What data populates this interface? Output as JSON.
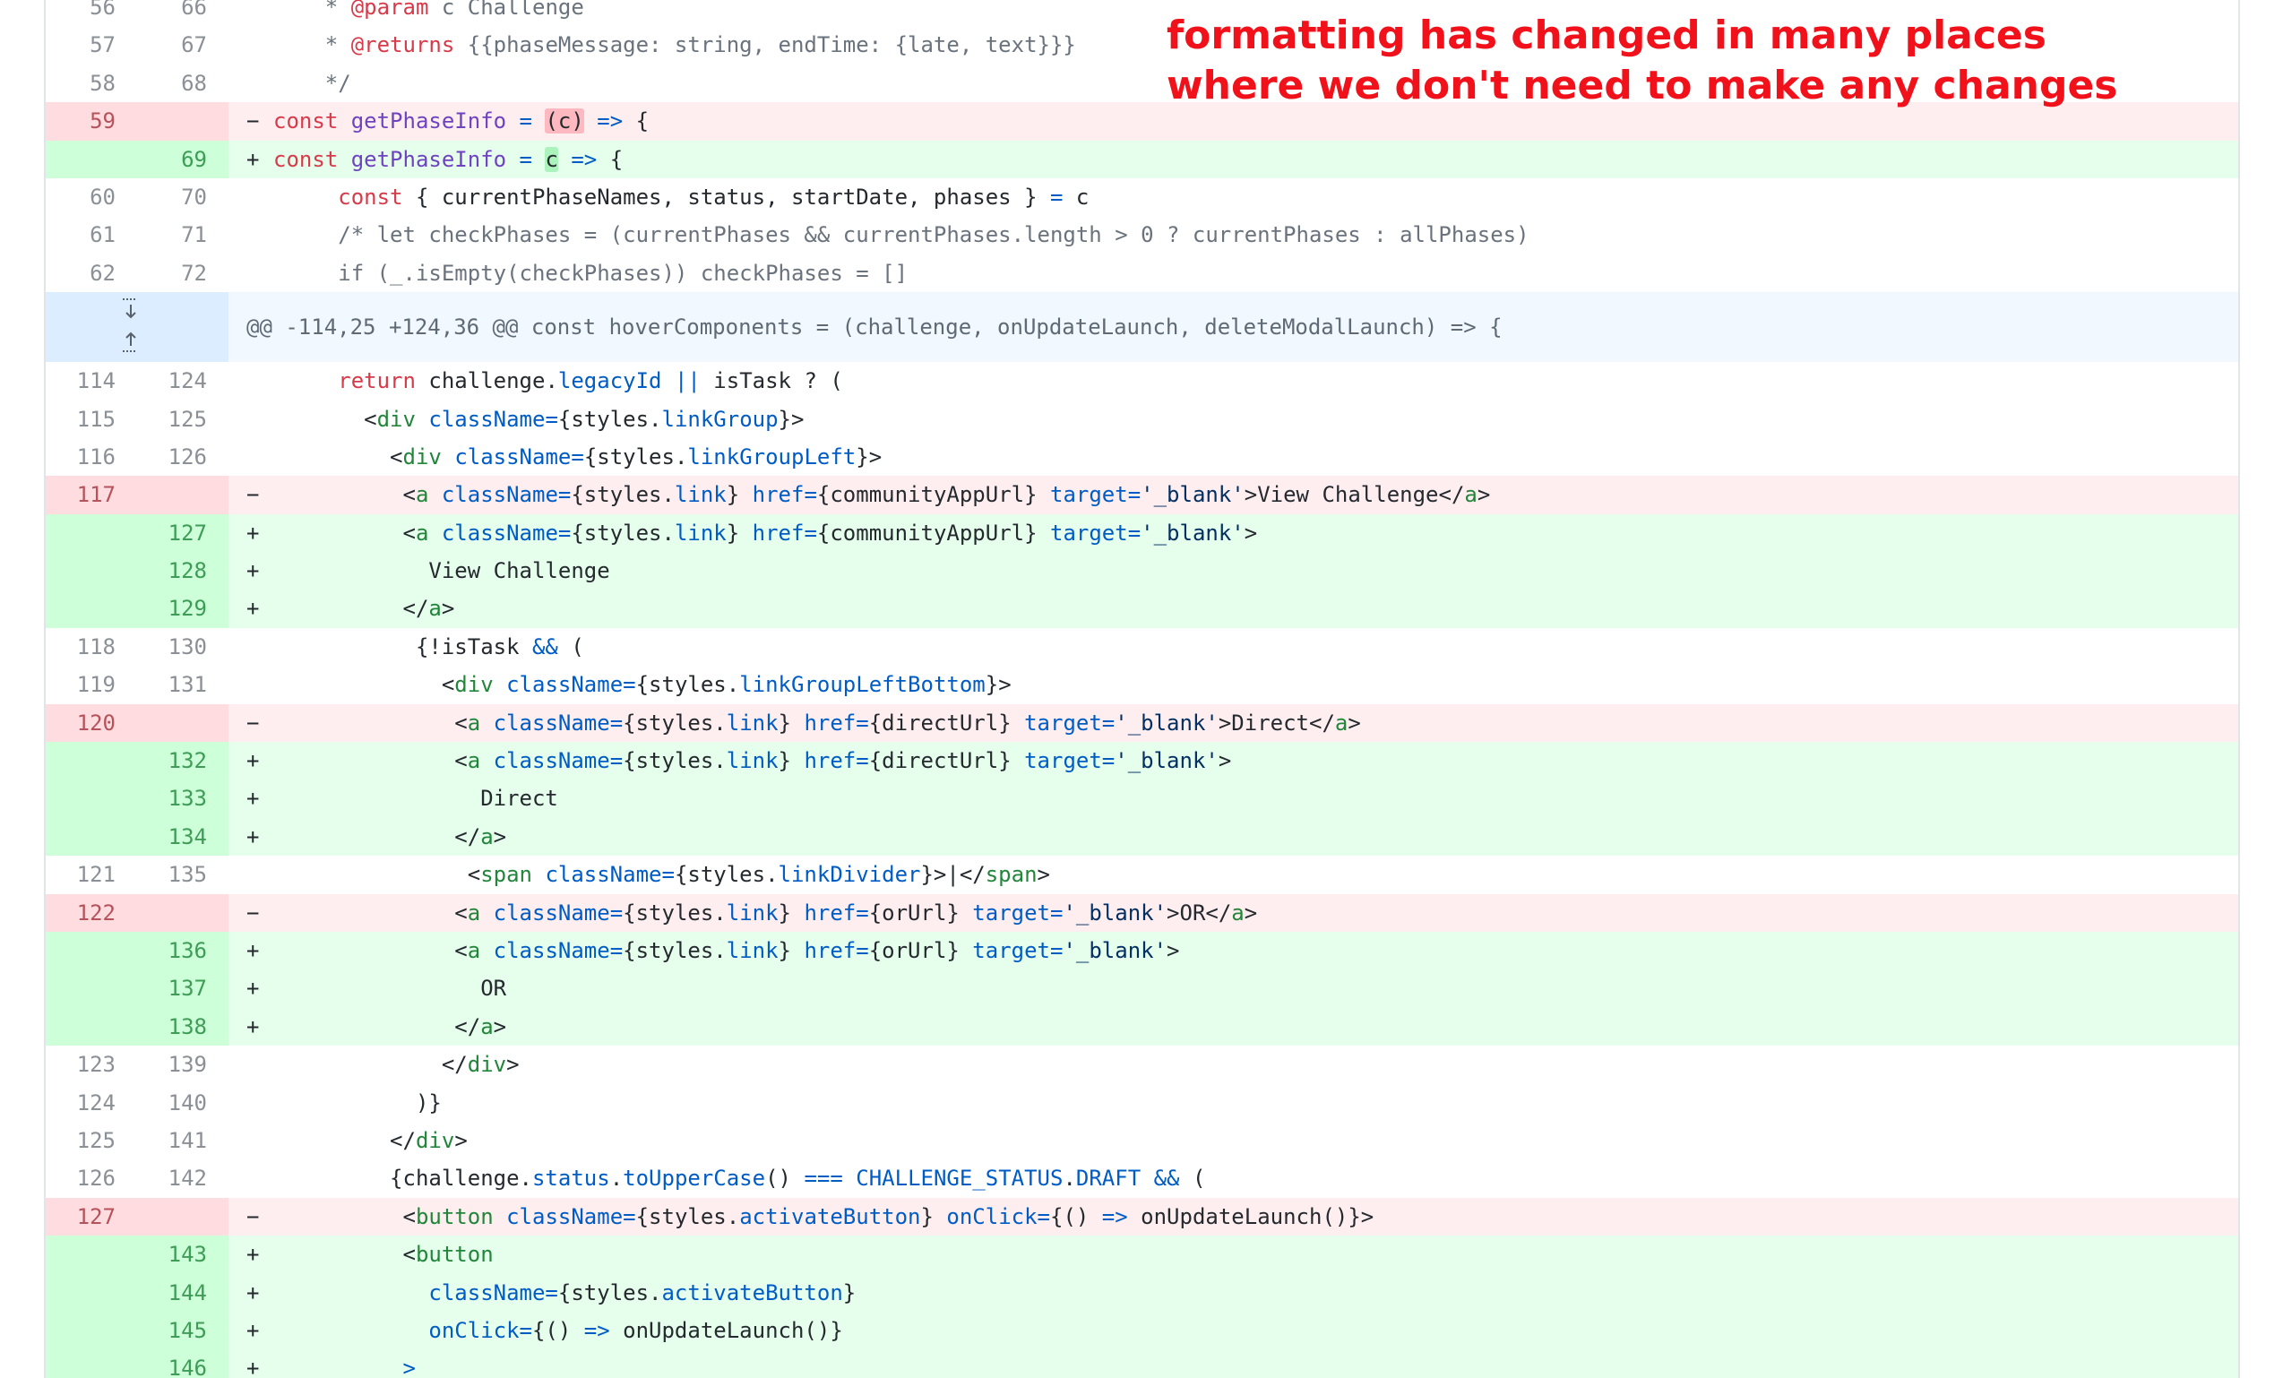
{
  "annotation": {
    "line1": "formatting has changed in many places",
    "line2": "where we don't need to make any changes"
  },
  "diff_lines": [
    {
      "type": "ctx",
      "old": "56",
      "new": "66",
      "tokens": [
        [
          "cm",
          "    * "
        ],
        [
          "kw",
          "@param"
        ],
        [
          "cm",
          " c Challenge"
        ]
      ]
    },
    {
      "type": "ctx",
      "old": "57",
      "new": "67",
      "tokens": [
        [
          "cm",
          "    * "
        ],
        [
          "kw",
          "@returns"
        ],
        [
          "cm",
          " {{phaseMessage: string, endTime: {late, text}}}"
        ]
      ]
    },
    {
      "type": "ctx",
      "old": "58",
      "new": "68",
      "tokens": [
        [
          "cm",
          "    */"
        ]
      ]
    },
    {
      "type": "del",
      "old": "59",
      "new": "",
      "marker": "−",
      "tokens": [
        [
          "kw",
          "const "
        ],
        [
          "fn",
          "getPhaseInfo"
        ],
        [
          "at",
          " = "
        ],
        [
          "hl-del",
          "(c)"
        ],
        [
          "at",
          " =>"
        ],
        [
          "",
          " {"
        ]
      ]
    },
    {
      "type": "add",
      "old": "",
      "new": "69",
      "marker": "+",
      "tokens": [
        [
          "kw",
          "const "
        ],
        [
          "fn",
          "getPhaseInfo"
        ],
        [
          "at",
          " = "
        ],
        [
          "hl-add",
          "c"
        ],
        [
          "at",
          " =>"
        ],
        [
          "",
          " {"
        ]
      ]
    },
    {
      "type": "ctx",
      "old": "60",
      "new": "70",
      "tokens": [
        [
          "",
          "     "
        ],
        [
          "kw",
          "const"
        ],
        [
          "",
          " { currentPhaseNames, status, startDate, phases } "
        ],
        [
          "at",
          "="
        ],
        [
          "",
          " c"
        ]
      ]
    },
    {
      "type": "ctx",
      "old": "61",
      "new": "71",
      "tokens": [
        [
          "cm",
          "     /* let checkPhases = (currentPhases && currentPhases.length > 0 ? currentPhases : allPhases)"
        ]
      ]
    },
    {
      "type": "ctx",
      "old": "62",
      "new": "72",
      "tokens": [
        [
          "cm",
          "     if (_.isEmpty(checkPhases)) checkPhases = []"
        ]
      ]
    },
    {
      "type": "hunk",
      "old": "",
      "new": "",
      "tokens": [
        [
          "",
          "@@ -114,25 +124,36 @@ const hoverComponents = (challenge, onUpdateLaunch, deleteModalLaunch) => {"
        ]
      ]
    },
    {
      "type": "ctx",
      "old": "114",
      "new": "124",
      "tokens": [
        [
          "",
          "     "
        ],
        [
          "kw",
          "return"
        ],
        [
          "",
          " challenge."
        ],
        [
          "at",
          "legacyId"
        ],
        [
          "",
          " "
        ],
        [
          "at",
          "||"
        ],
        [
          "",
          " isTask ? ("
        ]
      ]
    },
    {
      "type": "ctx",
      "old": "115",
      "new": "125",
      "tokens": [
        [
          "",
          "       <"
        ],
        [
          "tg",
          "div"
        ],
        [
          "",
          " "
        ],
        [
          "at",
          "className="
        ],
        [
          "",
          "{styles."
        ],
        [
          "at",
          "linkGroup"
        ],
        [
          "",
          "}>"
        ]
      ]
    },
    {
      "type": "ctx",
      "old": "116",
      "new": "126",
      "tokens": [
        [
          "",
          "         <"
        ],
        [
          "tg",
          "div"
        ],
        [
          "",
          " "
        ],
        [
          "at",
          "className="
        ],
        [
          "",
          "{styles."
        ],
        [
          "at",
          "linkGroupLeft"
        ],
        [
          "",
          "}>"
        ]
      ]
    },
    {
      "type": "del",
      "old": "117",
      "new": "",
      "marker": "−",
      "tokens": [
        [
          "",
          "          <"
        ],
        [
          "tg",
          "a"
        ],
        [
          "",
          " "
        ],
        [
          "at",
          "className="
        ],
        [
          "",
          "{styles."
        ],
        [
          "at",
          "link"
        ],
        [
          "",
          "} "
        ],
        [
          "at",
          "href="
        ],
        [
          "",
          "{communityAppUrl} "
        ],
        [
          "at",
          "target="
        ],
        [
          "st",
          "'_blank'"
        ],
        [
          "",
          ">View Challenge</"
        ],
        [
          "tg",
          "a"
        ],
        [
          "",
          ">"
        ]
      ]
    },
    {
      "type": "add",
      "old": "",
      "new": "127",
      "marker": "+",
      "tokens": [
        [
          "",
          "          <"
        ],
        [
          "tg",
          "a"
        ],
        [
          "",
          " "
        ],
        [
          "at",
          "className="
        ],
        [
          "",
          "{styles."
        ],
        [
          "at",
          "link"
        ],
        [
          "",
          "} "
        ],
        [
          "at",
          "href="
        ],
        [
          "",
          "{communityAppUrl} "
        ],
        [
          "at",
          "target="
        ],
        [
          "st",
          "'_blank'"
        ],
        [
          "",
          ">"
        ]
      ]
    },
    {
      "type": "add",
      "old": "",
      "new": "128",
      "marker": "+",
      "tokens": [
        [
          "",
          "            View Challenge"
        ]
      ]
    },
    {
      "type": "add",
      "old": "",
      "new": "129",
      "marker": "+",
      "tokens": [
        [
          "",
          "          </"
        ],
        [
          "tg",
          "a"
        ],
        [
          "",
          ">"
        ]
      ]
    },
    {
      "type": "ctx",
      "old": "118",
      "new": "130",
      "tokens": [
        [
          "",
          "           {!isTask "
        ],
        [
          "at",
          "&&"
        ],
        [
          "",
          " ("
        ]
      ]
    },
    {
      "type": "ctx",
      "old": "119",
      "new": "131",
      "tokens": [
        [
          "",
          "             <"
        ],
        [
          "tg",
          "div"
        ],
        [
          "",
          " "
        ],
        [
          "at",
          "className="
        ],
        [
          "",
          "{styles."
        ],
        [
          "at",
          "linkGroupLeftBottom"
        ],
        [
          "",
          "}>"
        ]
      ]
    },
    {
      "type": "del",
      "old": "120",
      "new": "",
      "marker": "−",
      "tokens": [
        [
          "",
          "              <"
        ],
        [
          "tg",
          "a"
        ],
        [
          "",
          " "
        ],
        [
          "at",
          "className="
        ],
        [
          "",
          "{styles."
        ],
        [
          "at",
          "link"
        ],
        [
          "",
          "} "
        ],
        [
          "at",
          "href="
        ],
        [
          "",
          "{directUrl} "
        ],
        [
          "at",
          "target="
        ],
        [
          "st",
          "'_blank'"
        ],
        [
          "",
          ">Direct</"
        ],
        [
          "tg",
          "a"
        ],
        [
          "",
          ">"
        ]
      ]
    },
    {
      "type": "add",
      "old": "",
      "new": "132",
      "marker": "+",
      "tokens": [
        [
          "",
          "              <"
        ],
        [
          "tg",
          "a"
        ],
        [
          "",
          " "
        ],
        [
          "at",
          "className="
        ],
        [
          "",
          "{styles."
        ],
        [
          "at",
          "link"
        ],
        [
          "",
          "} "
        ],
        [
          "at",
          "href="
        ],
        [
          "",
          "{directUrl} "
        ],
        [
          "at",
          "target="
        ],
        [
          "st",
          "'_blank'"
        ],
        [
          "",
          ">"
        ]
      ]
    },
    {
      "type": "add",
      "old": "",
      "new": "133",
      "marker": "+",
      "tokens": [
        [
          "",
          "                Direct"
        ]
      ]
    },
    {
      "type": "add",
      "old": "",
      "new": "134",
      "marker": "+",
      "tokens": [
        [
          "",
          "              </"
        ],
        [
          "tg",
          "a"
        ],
        [
          "",
          ">"
        ]
      ]
    },
    {
      "type": "ctx",
      "old": "121",
      "new": "135",
      "tokens": [
        [
          "",
          "               <"
        ],
        [
          "tg",
          "span"
        ],
        [
          "",
          " "
        ],
        [
          "at",
          "className="
        ],
        [
          "",
          "{styles."
        ],
        [
          "at",
          "linkDivider"
        ],
        [
          "",
          "}>|</"
        ],
        [
          "tg",
          "span"
        ],
        [
          "",
          ">"
        ]
      ]
    },
    {
      "type": "del",
      "old": "122",
      "new": "",
      "marker": "−",
      "tokens": [
        [
          "",
          "              <"
        ],
        [
          "tg",
          "a"
        ],
        [
          "",
          " "
        ],
        [
          "at",
          "className="
        ],
        [
          "",
          "{styles."
        ],
        [
          "at",
          "link"
        ],
        [
          "",
          "} "
        ],
        [
          "at",
          "href="
        ],
        [
          "",
          "{orUrl} "
        ],
        [
          "at",
          "target="
        ],
        [
          "st",
          "'_blank'"
        ],
        [
          "",
          ">OR</"
        ],
        [
          "tg",
          "a"
        ],
        [
          "",
          ">"
        ]
      ]
    },
    {
      "type": "add",
      "old": "",
      "new": "136",
      "marker": "+",
      "tokens": [
        [
          "",
          "              <"
        ],
        [
          "tg",
          "a"
        ],
        [
          "",
          " "
        ],
        [
          "at",
          "className="
        ],
        [
          "",
          "{styles."
        ],
        [
          "at",
          "link"
        ],
        [
          "",
          "} "
        ],
        [
          "at",
          "href="
        ],
        [
          "",
          "{orUrl} "
        ],
        [
          "at",
          "target="
        ],
        [
          "st",
          "'_blank'"
        ],
        [
          "",
          ">"
        ]
      ]
    },
    {
      "type": "add",
      "old": "",
      "new": "137",
      "marker": "+",
      "tokens": [
        [
          "",
          "                OR"
        ]
      ]
    },
    {
      "type": "add",
      "old": "",
      "new": "138",
      "marker": "+",
      "tokens": [
        [
          "",
          "              </"
        ],
        [
          "tg",
          "a"
        ],
        [
          "",
          ">"
        ]
      ]
    },
    {
      "type": "ctx",
      "old": "123",
      "new": "139",
      "tokens": [
        [
          "",
          "             </"
        ],
        [
          "tg",
          "div"
        ],
        [
          "",
          ">"
        ]
      ]
    },
    {
      "type": "ctx",
      "old": "124",
      "new": "140",
      "tokens": [
        [
          "",
          "           )}"
        ]
      ]
    },
    {
      "type": "ctx",
      "old": "125",
      "new": "141",
      "tokens": [
        [
          "",
          "         </"
        ],
        [
          "tg",
          "div"
        ],
        [
          "",
          ">"
        ]
      ]
    },
    {
      "type": "ctx",
      "old": "126",
      "new": "142",
      "tokens": [
        [
          "",
          "         {challenge."
        ],
        [
          "at",
          "status"
        ],
        [
          "",
          "."
        ],
        [
          "at",
          "toUpperCase"
        ],
        [
          "",
          "() "
        ],
        [
          "at",
          "==="
        ],
        [
          "",
          " "
        ],
        [
          "at",
          "CHALLENGE_STATUS"
        ],
        [
          "",
          "."
        ],
        [
          "at",
          "DRAFT"
        ],
        [
          "",
          " "
        ],
        [
          "at",
          "&&"
        ],
        [
          "",
          " ("
        ]
      ]
    },
    {
      "type": "del",
      "old": "127",
      "new": "",
      "marker": "−",
      "tokens": [
        [
          "",
          "          <"
        ],
        [
          "tg",
          "button"
        ],
        [
          "",
          " "
        ],
        [
          "at",
          "className="
        ],
        [
          "",
          "{styles."
        ],
        [
          "at",
          "activateButton"
        ],
        [
          "",
          "} "
        ],
        [
          "at",
          "onClick="
        ],
        [
          "",
          "{() "
        ],
        [
          "at",
          "=>"
        ],
        [
          "",
          " onUpdateLaunch()}>"
        ]
      ]
    },
    {
      "type": "add",
      "old": "",
      "new": "143",
      "marker": "+",
      "tokens": [
        [
          "",
          "          <"
        ],
        [
          "tg",
          "button"
        ]
      ]
    },
    {
      "type": "add",
      "old": "",
      "new": "144",
      "marker": "+",
      "tokens": [
        [
          "",
          "            "
        ],
        [
          "at",
          "className="
        ],
        [
          "",
          "{styles."
        ],
        [
          "at",
          "activateButton"
        ],
        [
          "",
          "}"
        ]
      ]
    },
    {
      "type": "add",
      "old": "",
      "new": "145",
      "marker": "+",
      "tokens": [
        [
          "",
          "            "
        ],
        [
          "at",
          "onClick="
        ],
        [
          "",
          "{() "
        ],
        [
          "at",
          "=>"
        ],
        [
          "",
          " onUpdateLaunch()}"
        ]
      ]
    },
    {
      "type": "add",
      "old": "",
      "new": "146",
      "marker": "+",
      "tokens": [
        [
          "",
          "          "
        ],
        [
          "at",
          ">"
        ]
      ]
    }
  ]
}
